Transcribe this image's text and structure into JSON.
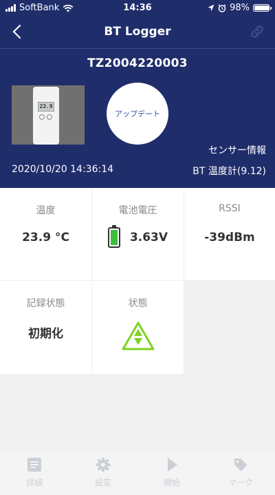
{
  "status_bar": {
    "carrier": "SoftBank",
    "time": "14:36",
    "battery_percent": "98%",
    "battery_level": 0.98
  },
  "header": {
    "title": "BT Logger",
    "icons": {
      "back": "chevron-left-icon",
      "link": "link-icon"
    }
  },
  "device": {
    "serial": "TZ2004220003",
    "update_label": "アップデート",
    "sensor_info_label": "センサー情報",
    "timestamp": "2020/10/20 14:36:14",
    "model": "BT 温度計(9.12)",
    "lcd_text": "23.9"
  },
  "tiles": {
    "temperature": {
      "label": "温度",
      "value": "23.9 °C"
    },
    "battery_voltage": {
      "label": "電池電圧",
      "value": "3.63V",
      "level": 1.0,
      "color": "#3cbf3c"
    },
    "rssi": {
      "label": "RSSI",
      "value": "-39dBm"
    },
    "record_state": {
      "label": "記録状態",
      "value": "初期化"
    },
    "state": {
      "label": "状態",
      "icon": "up-down-triangle-icon",
      "color": "#7ed321"
    }
  },
  "tabbar": {
    "items": [
      {
        "label": "詳細",
        "icon": "list-icon"
      },
      {
        "label": "設定",
        "icon": "gear-icon"
      },
      {
        "label": "開始",
        "icon": "play-icon"
      },
      {
        "label": "マーク",
        "icon": "tag-icon"
      }
    ]
  },
  "colors": {
    "header_bg": "#1f2d6b",
    "tab_inactive": "#cbcfd6",
    "update_text": "#3d56a8"
  }
}
